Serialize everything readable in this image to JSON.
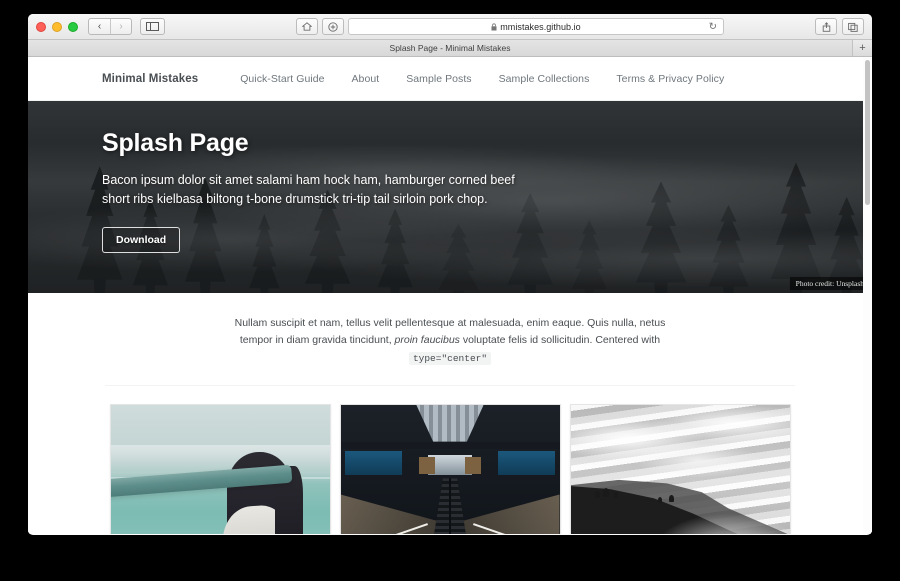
{
  "browser": {
    "traffic_lights": [
      "close",
      "minimize",
      "maximize"
    ],
    "back_glyph": "‹",
    "forward_glyph": "›",
    "sidebar_glyph": "▣",
    "home_glyph": "⌂",
    "add_glyph": "⊕",
    "reload_glyph": "↻",
    "share_glyph": "⇧",
    "tabs_glyph": "⧉",
    "new_tab_glyph": "+",
    "lock_glyph": "🔒",
    "url": "mmistakes.github.io",
    "tab_title": "Splash Page - Minimal Mistakes"
  },
  "site": {
    "brand": "Minimal Mistakes",
    "nav": [
      {
        "label": "Quick-Start Guide"
      },
      {
        "label": "About"
      },
      {
        "label": "Sample Posts"
      },
      {
        "label": "Sample Collections"
      },
      {
        "label": "Terms & Privacy Policy"
      }
    ]
  },
  "hero": {
    "title": "Splash Page",
    "excerpt": "Bacon ipsum dolor sit amet salami ham hock ham, hamburger corned beef short ribs kielbasa biltong t-bone drumstick tri-tip tail sirloin pork chop.",
    "button_label": "Download",
    "photo_credit": "Photo credit: Unsplash"
  },
  "content": {
    "intro_part1": "Nullam suscipit et nam, tellus velit pellentesque at malesuada, enim eaque. Quis nulla, netus tempor in diam gravida tincidunt, ",
    "intro_italic": "proin faucibus",
    "intro_part2": " voluptate felis id sollicitudin. Centered with ",
    "intro_code": "type=\"center\"",
    "features": [
      {
        "alt": "woman-with-teal-scarf-by-the-sea"
      },
      {
        "alt": "dark-escalator-hall-interior"
      },
      {
        "alt": "black-and-white-clouds-over-ridge"
      }
    ]
  },
  "colors": {
    "text": "#494e52",
    "muted": "#6f777d",
    "rule": "#f2f3f3",
    "window": "#ffffff"
  }
}
